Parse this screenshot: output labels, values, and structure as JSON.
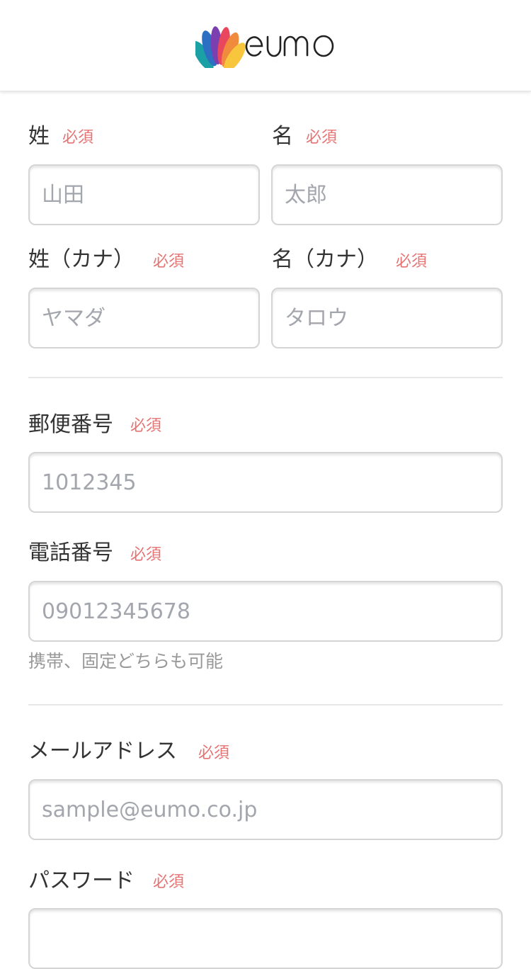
{
  "header": {
    "logo_text": "eumo"
  },
  "required_tag": "必須",
  "form": {
    "last_name": {
      "label": "姓",
      "placeholder": "山田"
    },
    "first_name": {
      "label": "名",
      "placeholder": "太郎"
    },
    "last_name_kana": {
      "label": "姓（カナ）",
      "placeholder": "ヤマダ"
    },
    "first_name_kana": {
      "label": "名（カナ）",
      "placeholder": "タロウ"
    },
    "postal_code": {
      "label": "郵便番号",
      "placeholder": "1012345"
    },
    "phone": {
      "label": "電話番号",
      "placeholder": "09012345678",
      "hint": "携帯、固定どちらも可能"
    },
    "email": {
      "label": "メールアドレス",
      "placeholder": "sample@eumo.co.jp"
    },
    "password": {
      "label": "パスワード",
      "placeholder": ""
    }
  },
  "colors": {
    "required": "#e57373",
    "placeholder": "#a4a6ad",
    "border": "#d5d5d8",
    "logo_petals": [
      "#1aa0a5",
      "#2d6fc2",
      "#7b3fb0",
      "#e8475e",
      "#f08a3c",
      "#f7c63d"
    ]
  }
}
